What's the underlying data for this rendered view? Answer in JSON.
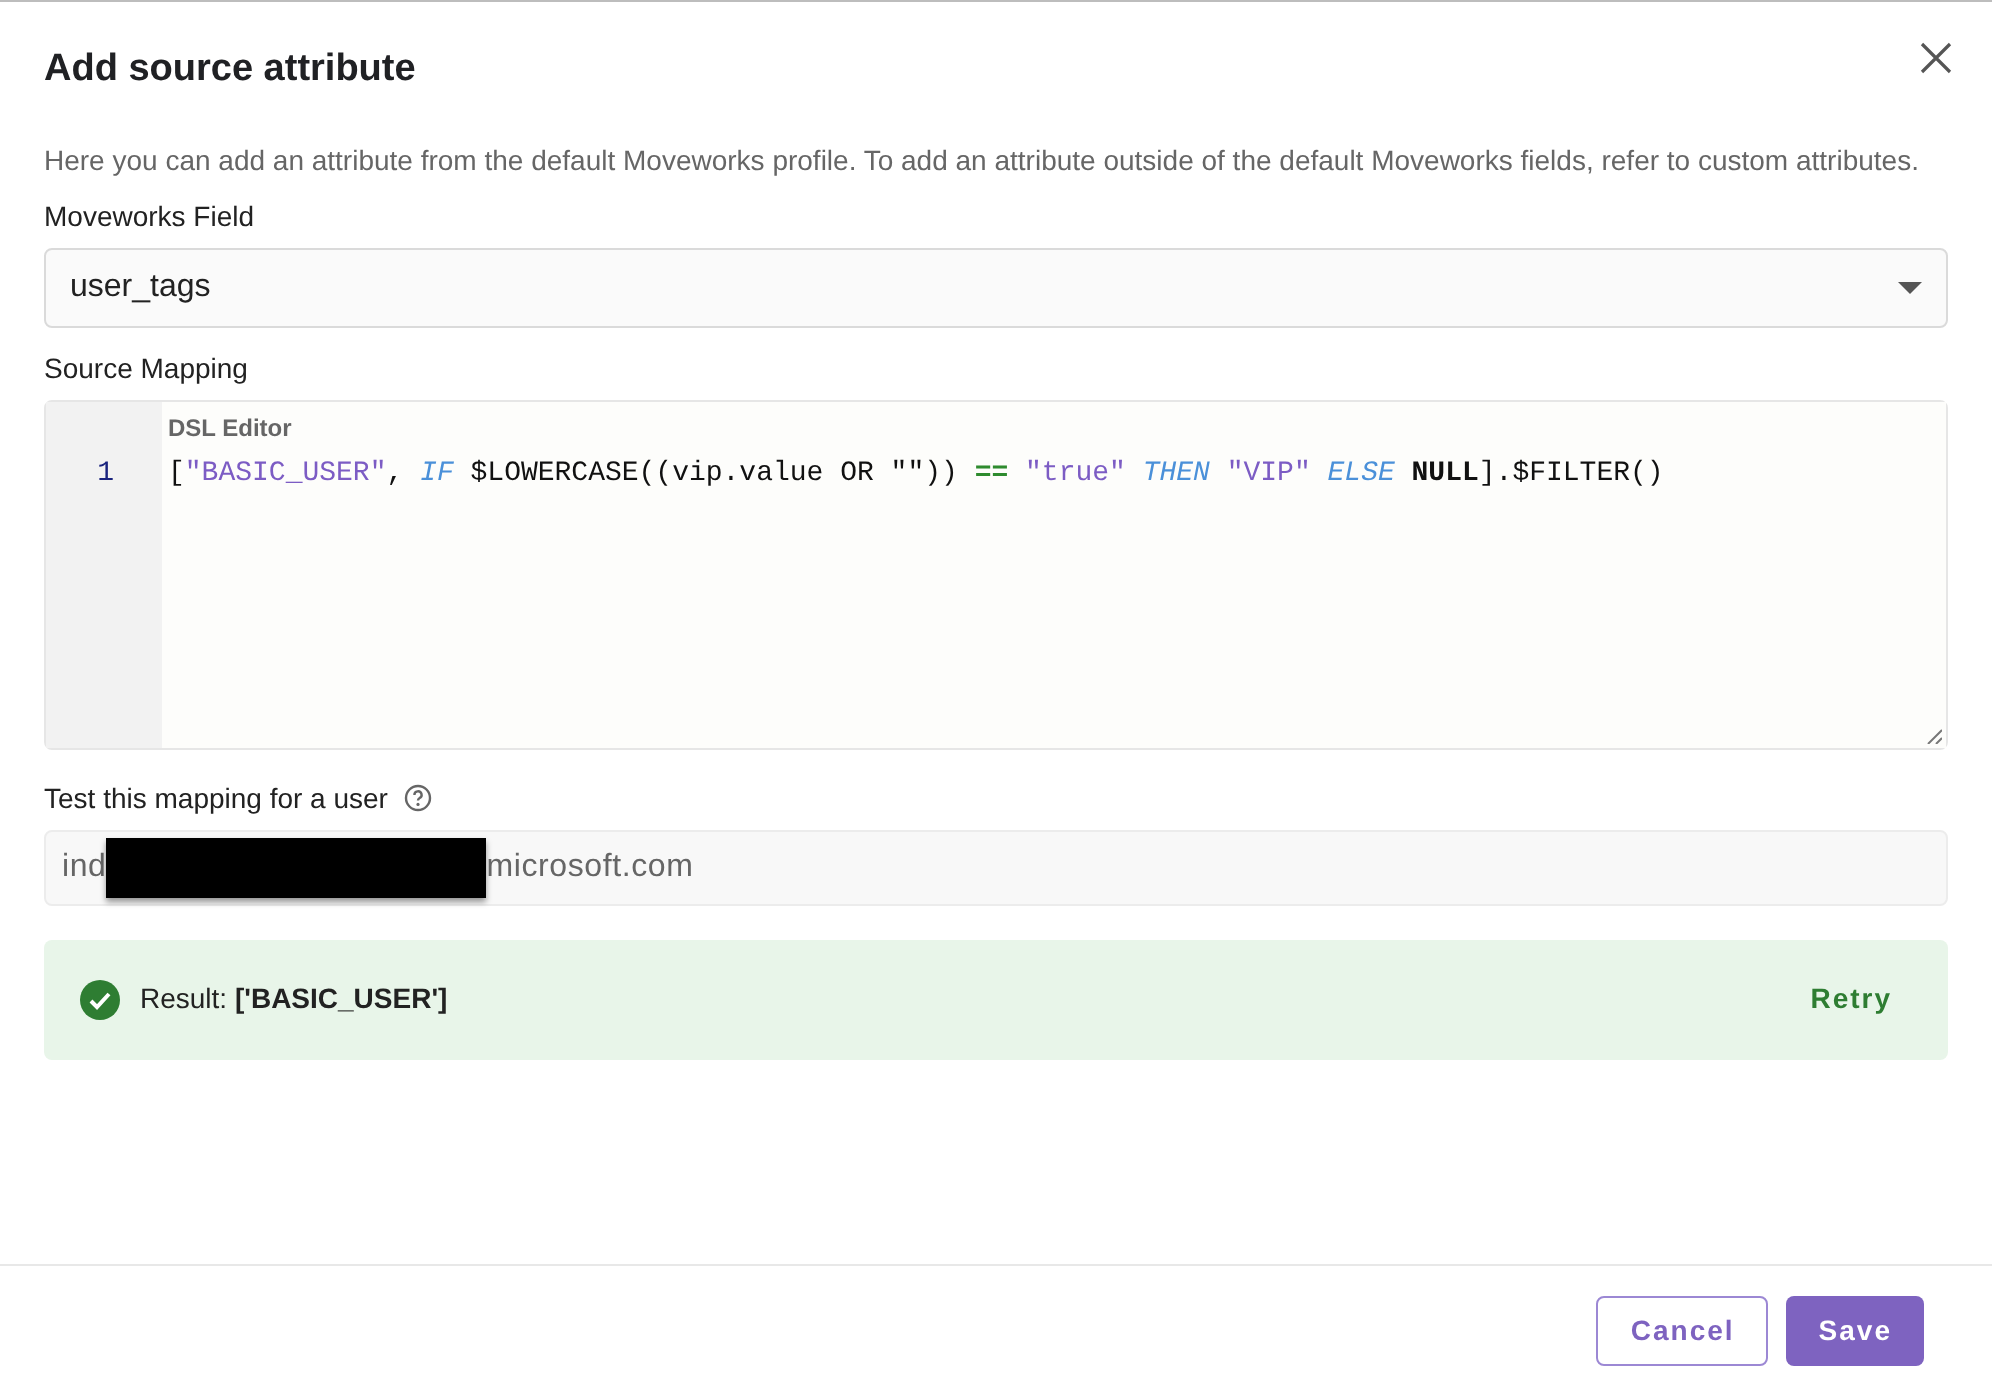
{
  "dialog": {
    "title": "Add source attribute",
    "description": "Here you can add an attribute from the default Moveworks profile. To add an attribute outside of the default Moveworks fields, refer to custom attributes."
  },
  "moveworks_field": {
    "label": "Moveworks Field",
    "value": "user_tags"
  },
  "source_mapping": {
    "label": "Source Mapping",
    "editor_label": "DSL Editor",
    "lines": [
      {
        "number": "1",
        "tokens": [
          {
            "kind": "plain",
            "text": "["
          },
          {
            "kind": "string",
            "text": "\"BASIC_USER\""
          },
          {
            "kind": "plain",
            "text": ", "
          },
          {
            "kind": "keyword",
            "text": "IF"
          },
          {
            "kind": "plain",
            "text": " $LOWERCASE((vip.value OR \"\")) "
          },
          {
            "kind": "operator",
            "text": "=="
          },
          {
            "kind": "string",
            "text": " \"true\" "
          },
          {
            "kind": "keyword",
            "text": "THEN"
          },
          {
            "kind": "string",
            "text": " \"VIP\" "
          },
          {
            "kind": "keyword",
            "text": "ELSE"
          },
          {
            "kind": "constant",
            "text": " NULL"
          },
          {
            "kind": "plain",
            "text": "].$FILTER()"
          }
        ]
      }
    ]
  },
  "test_user": {
    "label": "Test this mapping for a user",
    "value_start": "ind",
    "redacted": true,
    "value_end": "microsoft.com"
  },
  "result": {
    "success": true,
    "text": "Result: **['BASIC_USER']**",
    "action": "Retry"
  },
  "buttons": [
    {
      "label": "Cancel",
      "kind": "secondary"
    },
    {
      "label": "Save",
      "kind": "primary"
    }
  ]
}
